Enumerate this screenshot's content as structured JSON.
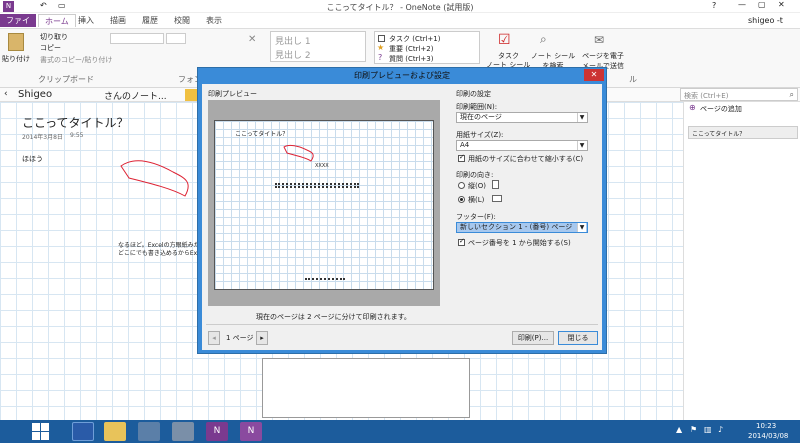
{
  "window": {
    "title": "ここってタイトル？ - OneNote (試用版)",
    "user": "shigeo -t"
  },
  "tabs": [
    "ファイル",
    "ホーム",
    "挿入",
    "描画",
    "履歴",
    "校閲",
    "表示"
  ],
  "ribbon": {
    "clipboard": {
      "paste": "貼り付け",
      "cut": "切り取り",
      "copy": "コピー",
      "format_painter": "書式のコピー/貼り付け",
      "label": "クリップボード"
    },
    "font_label": "フォン",
    "styles": [
      "見出し 1",
      "見出し 2"
    ],
    "tags": [
      "タスク (Ctrl+1)",
      "重要 (Ctrl+2)",
      "質問 (Ctrl+3)"
    ],
    "task_button": "タスク",
    "outlook_task": "ノート シール",
    "find_tags": "ノート シールを検索",
    "email_page": "ページを電子メールで送信",
    "tags_label": "ル"
  },
  "notebook": {
    "name": "Shigeo",
    "section": "さんのノート..."
  },
  "search": {
    "placeholder": "検索 (Ctrl+E)"
  },
  "pages": {
    "add": "ページの追加",
    "items": [
      "ここってタイトル？"
    ]
  },
  "note": {
    "title": "ここってタイトル？",
    "date": "2014年3月8日",
    "time": "9:55",
    "text1": "ほほう",
    "text2": "なるほど。Excelの方眼紙みたい",
    "text3": "どこにでも書き込めるからExc"
  },
  "dialog": {
    "title": "印刷プレビューおよび設定",
    "preview_label": "印刷プレビュー",
    "preview_title": "ここってタイトル？",
    "preview_mark": "XXXX",
    "note": "現在のページは 2 ページに分けて印刷されます。",
    "page_indicator": "1 ページ",
    "settings_label": "印刷の設定",
    "range_label": "印刷範囲(N):",
    "range_value": "現在のページ",
    "paper_label": "用紙サイズ(Z):",
    "paper_value": "A4",
    "fit_label": "用紙のサイズに合わせて縮小する(C)",
    "orientation_label": "印刷の向き:",
    "portrait": "縦(O)",
    "landscape": "横(L)",
    "footer_label": "フッター(F):",
    "footer_value": "新しいセクション 1 - (番号) ページ",
    "start_label": "ページ番号を 1 から開始する(S)",
    "print_button": "印刷(P)...",
    "close_button": "閉じる"
  },
  "taskbar": {
    "time": "10:23",
    "date": "2014/03/08"
  },
  "colors": {
    "accent": "#7a3a8f",
    "taskbar": "#1c5c9c",
    "dialog_border": "#3a8bd8",
    "highlight": "#a7c8ee"
  }
}
